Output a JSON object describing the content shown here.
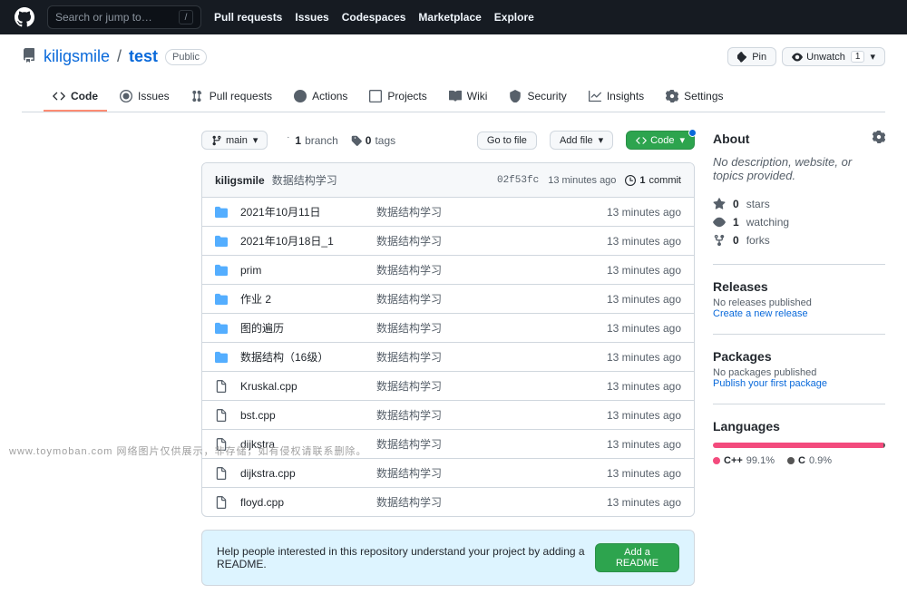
{
  "search_placeholder": "Search or jump to…",
  "topnav": [
    "Pull requests",
    "Issues",
    "Codespaces",
    "Marketplace",
    "Explore"
  ],
  "repo": {
    "owner": "kiligsmile",
    "name": "test",
    "visibility": "Public"
  },
  "actions": {
    "pin": "Pin",
    "unwatch": "Unwatch",
    "unwatch_count": "1"
  },
  "tabs": {
    "code": "Code",
    "issues": "Issues",
    "pulls": "Pull requests",
    "actions": "Actions",
    "projects": "Projects",
    "wiki": "Wiki",
    "security": "Security",
    "insights": "Insights",
    "settings": "Settings"
  },
  "branch": {
    "label": "main",
    "branches_n": "1",
    "branches_l": "branch",
    "tags_n": "0",
    "tags_l": "tags"
  },
  "buttons": {
    "gotofile": "Go to file",
    "addfile": "Add file",
    "code": "Code"
  },
  "commit": {
    "author": "kiligsmile",
    "message": "数据结构学习",
    "sha": "02f53fc",
    "time": "13 minutes ago",
    "count": "1",
    "count_l": "commit"
  },
  "files": [
    {
      "type": "dir",
      "name": "2021年10月11日",
      "msg": "数据结构学习",
      "time": "13 minutes ago"
    },
    {
      "type": "dir",
      "name": "2021年10月18日_1",
      "msg": "数据结构学习",
      "time": "13 minutes ago"
    },
    {
      "type": "dir",
      "name": "prim",
      "msg": "数据结构学习",
      "time": "13 minutes ago"
    },
    {
      "type": "dir",
      "name": "作业 2",
      "msg": "数据结构学习",
      "time": "13 minutes ago"
    },
    {
      "type": "dir",
      "name": "图的遍历",
      "msg": "数据结构学习",
      "time": "13 minutes ago"
    },
    {
      "type": "dir",
      "name": "数据结构（16级）",
      "msg": "数据结构学习",
      "time": "13 minutes ago"
    },
    {
      "type": "file",
      "name": "Kruskal.cpp",
      "msg": "数据结构学习",
      "time": "13 minutes ago"
    },
    {
      "type": "file",
      "name": "bst.cpp",
      "msg": "数据结构学习",
      "time": "13 minutes ago"
    },
    {
      "type": "file",
      "name": "dijkstra",
      "msg": "数据结构学习",
      "time": "13 minutes ago"
    },
    {
      "type": "file",
      "name": "dijkstra.cpp",
      "msg": "数据结构学习",
      "time": "13 minutes ago"
    },
    {
      "type": "file",
      "name": "floyd.cpp",
      "msg": "数据结构学习",
      "time": "13 minutes ago"
    }
  ],
  "readme": {
    "text": "Help people interested in this repository understand your project by adding a README.",
    "btn": "Add a README"
  },
  "about": {
    "title": "About",
    "desc": "No description, website, or topics provided.",
    "stars_n": "0",
    "stars_l": "stars",
    "watch_n": "1",
    "watch_l": "watching",
    "fork_n": "0",
    "fork_l": "forks"
  },
  "releases": {
    "title": "Releases",
    "none": "No releases published",
    "link": "Create a new release"
  },
  "packages": {
    "title": "Packages",
    "none": "No packages published",
    "link": "Publish your first package"
  },
  "languages": {
    "title": "Languages",
    "items": [
      {
        "name": "C++",
        "pct": "99.1%",
        "color": "#f34b7d"
      },
      {
        "name": "C",
        "pct": "0.9%",
        "color": "#555555"
      }
    ]
  },
  "watermark": "www.toymoban.com 网络图片仅供展示，非存储，如有侵权请联系删除。"
}
